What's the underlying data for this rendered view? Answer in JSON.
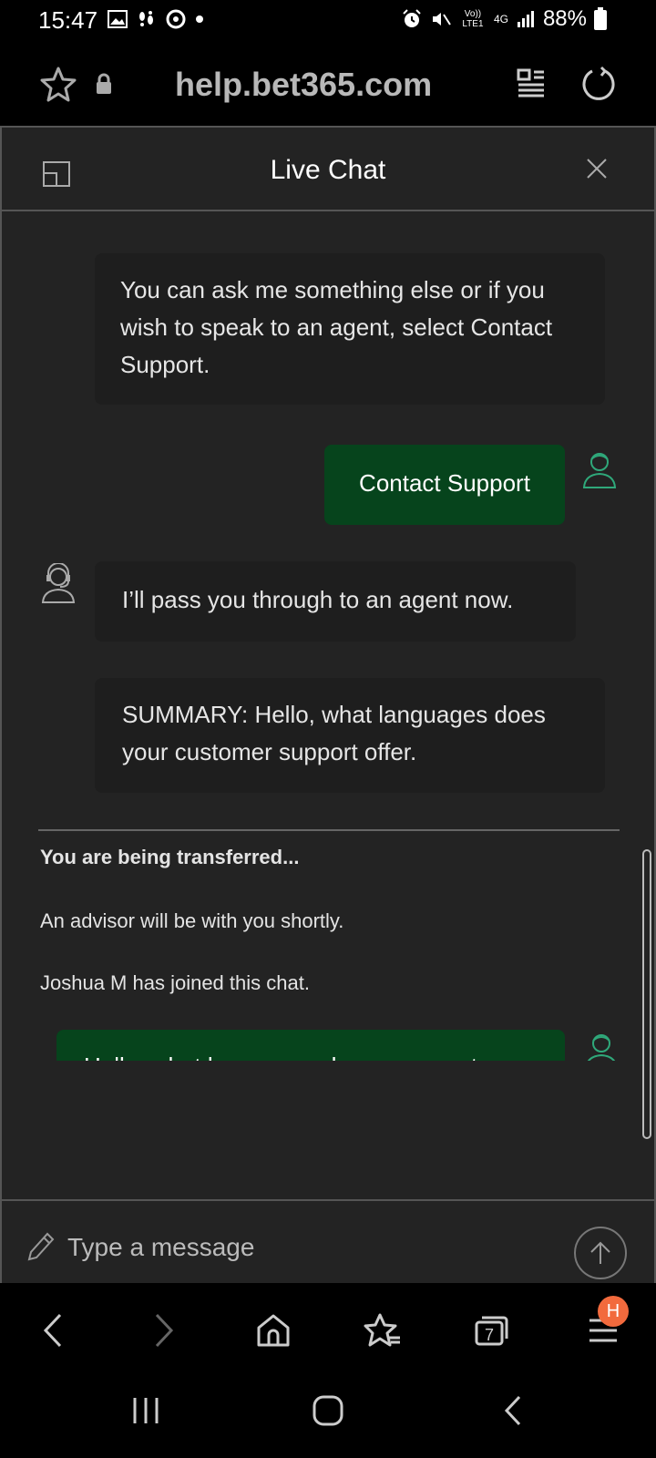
{
  "status_bar": {
    "time": "15:47",
    "battery_percent": "88%",
    "left_icons": [
      "image-icon",
      "footsteps-icon",
      "chrome-icon",
      "dot-icon"
    ],
    "right_icons": [
      "alarm-icon",
      "mute-icon",
      "volte-icon",
      "4g-icon",
      "signal-icon",
      "battery-icon"
    ],
    "volte_label": "Vo)) LTE1",
    "network_label": "4G"
  },
  "url_bar": {
    "url": "help.bet365.com"
  },
  "chat": {
    "title": "Live Chat",
    "messages": [
      {
        "from": "bot",
        "text": "You can ask me something else or if you wish to speak to an agent, select Contact Support."
      },
      {
        "from": "user",
        "text": "Contact Support"
      },
      {
        "from": "bot",
        "text": "I’ll pass you through to an agent now."
      },
      {
        "from": "bot",
        "text": "SUMMARY: Hello, what languages does your customer support offer."
      },
      {
        "from": "user",
        "text": "Hello, what languages does your customer support offer."
      }
    ],
    "transfer": {
      "heading": "You are being transferred...",
      "line1": "An advisor will be with you shortly.",
      "line2": "Joshua M has joined this chat."
    },
    "composer": {
      "placeholder": "Type a message"
    }
  },
  "browser_nav": {
    "tabs_count": "7",
    "menu_badge": "H"
  },
  "colors": {
    "panel_bg": "#232323",
    "bubble_bot": "#1e1e1e",
    "bubble_user": "#06441c",
    "avatar_user": "#2fa87a",
    "badge": "#f26a3d"
  }
}
